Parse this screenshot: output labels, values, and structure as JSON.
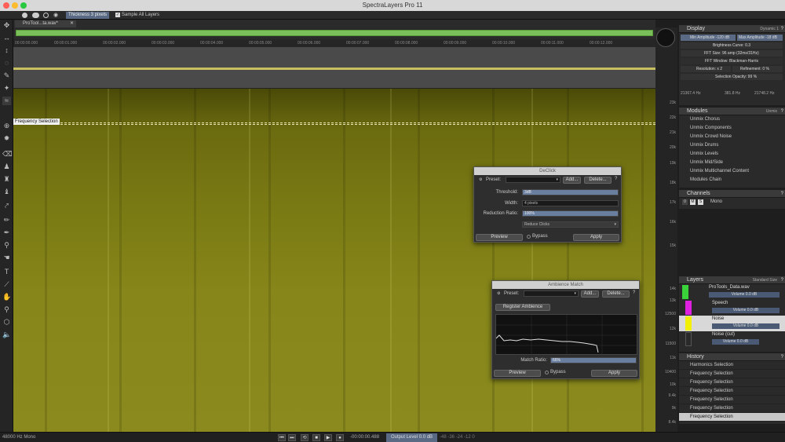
{
  "app": {
    "title": "SpectraLayers Pro 11"
  },
  "toolbar": {
    "thickness": "Thickness 3 pixels",
    "sample_all": "Sample All Layers"
  },
  "tabs": [
    {
      "label": "ProTool...ta.wav*"
    }
  ],
  "ruler": [
    "00:00:00.000",
    "00:00:01.000",
    "00:00:02.000",
    "00:00:03.000",
    "00:00:04.000",
    "00:00:05.000",
    "00:00:06.000",
    "00:00:07.000",
    "00:00:08.000",
    "00:00:09.000",
    "00:00:10.000",
    "00:00:11.000",
    "00:00:12.000"
  ],
  "spectro": {
    "freq_label": "Frequency Selection"
  },
  "scale": [
    "23k",
    "22k",
    "21k",
    "20k",
    "19k",
    "18k",
    "17k",
    "16k",
    "15k",
    "14k",
    "13k",
    "12500",
    "12k",
    "11500",
    "11k",
    "10400",
    "10k",
    "9.4k",
    "9k",
    "8.4k"
  ],
  "declick": {
    "title": "DeClick",
    "preset_label": "Preset:",
    "add": "Add...",
    "delete": "Delete...",
    "threshold_label": "Threshold:",
    "threshold": "3dB",
    "width_label": "Width:",
    "width": "4 pixels",
    "reduction_label": "Reduction Ratio:",
    "reduction": "100%",
    "mode": "Reduce Clicks",
    "preview": "Preview",
    "bypass": "Bypass",
    "apply": "Apply"
  },
  "ambience": {
    "title": "Ambience Match",
    "preset_label": "Preset:",
    "add": "Add...",
    "delete": "Delete...",
    "register": "Register Ambience",
    "match_label": "Match Ratio:",
    "match": "66%",
    "preview": "Preview",
    "bypass": "Bypass",
    "apply": "Apply"
  },
  "display": {
    "title": "Display",
    "mode": "Dynamic 1",
    "min_amp": "Min Amplitude -120 dB",
    "max_amp": "Max Amplitude -18 dB",
    "brightness": "Brightness Curve: 0.3",
    "fft": "FFT Size: 96 amp (32ms/31Hz)",
    "window": "FFT Window: Blackman-Harris",
    "resolution": "Resolution: x 2",
    "refinement": "Refinement: 0 %",
    "opacity": "Selection Opacity: 99 %",
    "coords": [
      "21367.4 Hz",
      "381.8 Hz",
      "21748.2 Hz"
    ]
  },
  "modules": {
    "title": "Modules",
    "filter": "Unmix",
    "items": [
      "Unmix Chorus",
      "Unmix Components",
      "Unmix Crowd Noise",
      "Unmix Drums",
      "Unmix Levels",
      "Unmix Mid/Side",
      "Unmix Multichannel Content",
      "Modules Chain"
    ]
  },
  "channels": {
    "title": "Channels",
    "item": "Mono"
  },
  "layers": {
    "title": "Layers",
    "size": "Standard Size",
    "items": [
      {
        "name": "ProTools_Data.wav",
        "volume": "Volume 0.0 dB",
        "color": "#3ad43a"
      },
      {
        "name": "Speech",
        "volume": "Volume 0.0 dB",
        "color": "#e020e0"
      },
      {
        "name": "Noise",
        "volume": "Volume 0.0 dB",
        "color": "#f0f000"
      },
      {
        "name": "Noise (cut)",
        "volume": "Volume 0.0 dB",
        "color": "#2a2a2a"
      }
    ]
  },
  "history": {
    "title": "History",
    "items": [
      "Harmonics Selection",
      "Frequency Selection",
      "Frequency Selection",
      "Frequency Selection",
      "Frequency Selection",
      "Frequency Selection",
      "Frequency Selection"
    ]
  },
  "status": {
    "format": "48000 Hz Mono",
    "time": "-00:00:00.488",
    "output": "Output Level 0.0 dB",
    "meter": "-48  -36  -24  -12  0"
  }
}
